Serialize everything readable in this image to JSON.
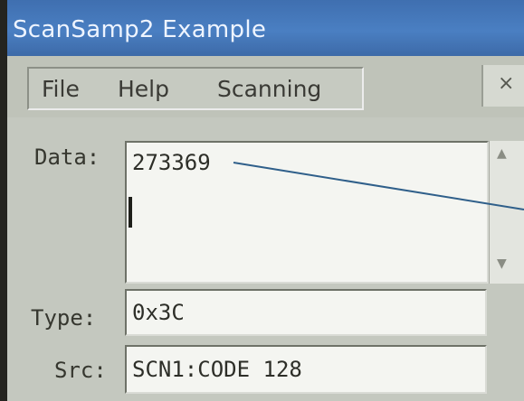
{
  "window": {
    "title": "ScanSamp2 Example"
  },
  "menu": {
    "items": [
      "File",
      "Help",
      "Scanning"
    ],
    "close_label": "×"
  },
  "form": {
    "data_label": "Data:",
    "data_value": "273369",
    "type_label": "Type:",
    "type_value": "0x3C",
    "src_label": "Src:",
    "src_value": "SCN1:CODE 128"
  },
  "scrollbar": {
    "up_glyph": "▲",
    "down_glyph": "▼"
  },
  "colors": {
    "titlebar": "#4a7fc2",
    "annotation_line": "#2f5f8a"
  }
}
